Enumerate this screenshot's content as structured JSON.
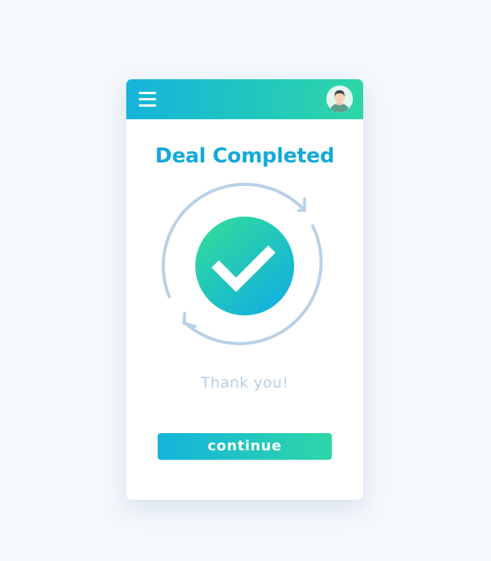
{
  "header": {
    "menu_icon": "hamburger-menu-icon",
    "avatar_icon": "user-avatar-icon"
  },
  "main": {
    "title": "Deal Completed",
    "status_icon": "checkmark-icon",
    "cycle_icon": "refresh-arrows-icon",
    "message": "Thank you!",
    "continue_label": "continue"
  },
  "colors": {
    "background": "#f5f8fc",
    "gradient_start": "#14b4dc",
    "gradient_end": "#2ed6a6",
    "title": "#14a9d8",
    "arrows": "#b9d0e8",
    "message": "#b8cde2"
  }
}
